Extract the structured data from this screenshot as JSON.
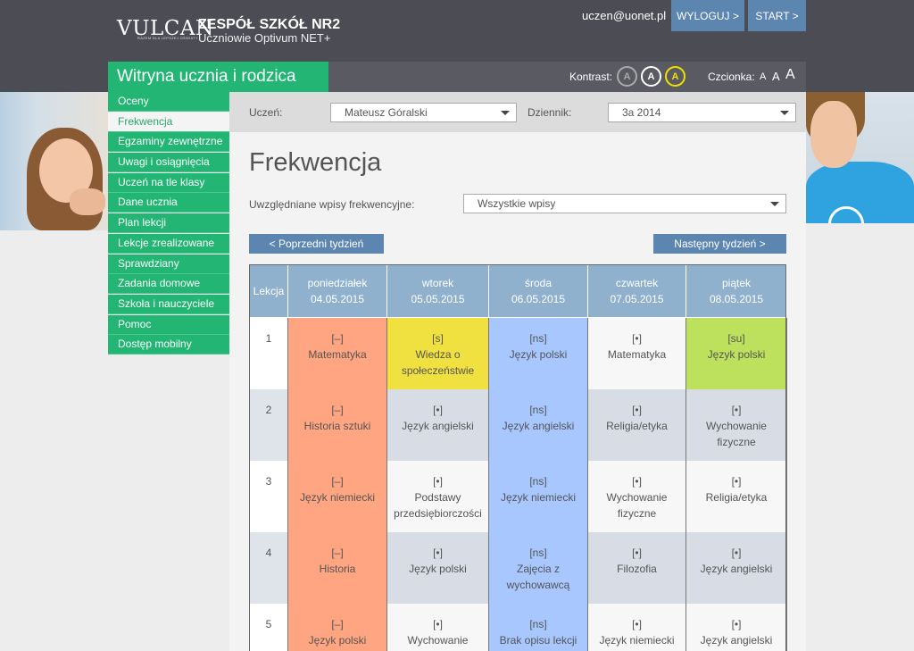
{
  "header": {
    "logo": "VULCAN",
    "logo_sub": "RAZEM DLA LEPSZEJ OŚWIATY",
    "school_name": "ZESPÓŁ SZKÓŁ NR2",
    "school_sub": "Uczniowie Optivum NET+",
    "user_email": "uczen@uonet.pl",
    "logout_label": "WYLOGUJ >",
    "start_label": "START >"
  },
  "subheader": {
    "title": "Witryna ucznia i rodzica",
    "contrast_label": "Kontrast:",
    "contrast_options": [
      "A",
      "A",
      "A"
    ],
    "font_label": "Czcionka:",
    "font_sizes": [
      "A",
      "A",
      "A"
    ]
  },
  "sidebar": {
    "items": [
      {
        "label": "Oceny"
      },
      {
        "label": "Frekwencja"
      },
      {
        "label": "Egzaminy zewnętrzne"
      },
      {
        "label": "Uwagi i osiągnięcia"
      },
      {
        "label": "Uczeń na tle klasy"
      },
      {
        "label": "Dane ucznia"
      },
      {
        "label": "Plan lekcji"
      },
      {
        "label": "Lekcje zrealizowane"
      },
      {
        "label": "Sprawdziany"
      },
      {
        "label": "Zadania domowe"
      },
      {
        "label": "Szkoła i nauczyciele"
      },
      {
        "label": "Pomoc"
      },
      {
        "label": "Dostęp mobilny"
      }
    ],
    "active_index": 1
  },
  "filters": {
    "student_label": "Uczeń:",
    "student_value": "Mateusz Góralski",
    "journal_label": "Dziennik:",
    "journal_value": "3a 2014"
  },
  "page": {
    "title": "Frekwencja",
    "entries_label": "Uwzględniane wpisy frekwencyjne:",
    "entries_value": "Wszystkie wpisy",
    "prev_week": "< Poprzedni tydzień",
    "next_week": "Następny tydzień >"
  },
  "attendance": {
    "lesson_header": "Lekcja",
    "days": [
      {
        "name": "poniedziałek",
        "date": "04.05.2015"
      },
      {
        "name": "wtorek",
        "date": "05.05.2015"
      },
      {
        "name": "środa",
        "date": "06.05.2015"
      },
      {
        "name": "czwartek",
        "date": "07.05.2015"
      },
      {
        "name": "piątek",
        "date": "08.05.2015"
      }
    ],
    "rows": [
      {
        "lesson": "1",
        "cells": [
          {
            "code": "[–]",
            "subject": "Matematyka",
            "status": "absent"
          },
          {
            "code": "[s]",
            "subject": "Wiedza o społeczeństwie",
            "status": "late"
          },
          {
            "code": "[ns]",
            "subject": "Język polski",
            "status": "excused"
          },
          {
            "code": "[•]",
            "subject": "Matematyka",
            "status": "present"
          },
          {
            "code": "[su]",
            "subject": "Język polski",
            "status": "su"
          }
        ]
      },
      {
        "lesson": "2",
        "cells": [
          {
            "code": "[–]",
            "subject": "Historia sztuki",
            "status": "absent"
          },
          {
            "code": "[•]",
            "subject": "Język angielski",
            "status": "present"
          },
          {
            "code": "[ns]",
            "subject": "Język angielski",
            "status": "excused"
          },
          {
            "code": "[•]",
            "subject": "Religia/etyka",
            "status": "present"
          },
          {
            "code": "[•]",
            "subject": "Wychowanie fizyczne",
            "status": "present"
          }
        ]
      },
      {
        "lesson": "3",
        "cells": [
          {
            "code": "[–]",
            "subject": "Język niemiecki",
            "status": "absent"
          },
          {
            "code": "[•]",
            "subject": "Podstawy przedsiębiorczości",
            "status": "present"
          },
          {
            "code": "[ns]",
            "subject": "Język niemiecki",
            "status": "excused"
          },
          {
            "code": "[•]",
            "subject": "Wychowanie fizyczne",
            "status": "present"
          },
          {
            "code": "[•]",
            "subject": "Religia/etyka",
            "status": "present"
          }
        ]
      },
      {
        "lesson": "4",
        "cells": [
          {
            "code": "[–]",
            "subject": "Historia",
            "status": "absent"
          },
          {
            "code": "[•]",
            "subject": "Język polski",
            "status": "present"
          },
          {
            "code": "[ns]",
            "subject": "Zajęcia z wychowawcą",
            "status": "excused"
          },
          {
            "code": "[•]",
            "subject": "Filozofia",
            "status": "present"
          },
          {
            "code": "[•]",
            "subject": "Język angielski",
            "status": "present"
          }
        ]
      },
      {
        "lesson": "5",
        "cells": [
          {
            "code": "[–]",
            "subject": "Język polski",
            "status": "absent"
          },
          {
            "code": "[•]",
            "subject": "Wychowanie",
            "status": "present"
          },
          {
            "code": "[ns]",
            "subject": "Brak opisu lekcji",
            "status": "excused"
          },
          {
            "code": "[•]",
            "subject": "Język niemiecki",
            "status": "present"
          },
          {
            "code": "[•]",
            "subject": "Język angielski",
            "status": "present"
          }
        ]
      }
    ]
  },
  "colors": {
    "header_bg": "#4c4c55",
    "brand_green": "#22b573",
    "button_blue": "#5c86b0",
    "table_header": "#8fb1cd",
    "absent": "#ffa582",
    "excused": "#a7c7fe",
    "late": "#f0e040",
    "su": "#bde15c"
  }
}
